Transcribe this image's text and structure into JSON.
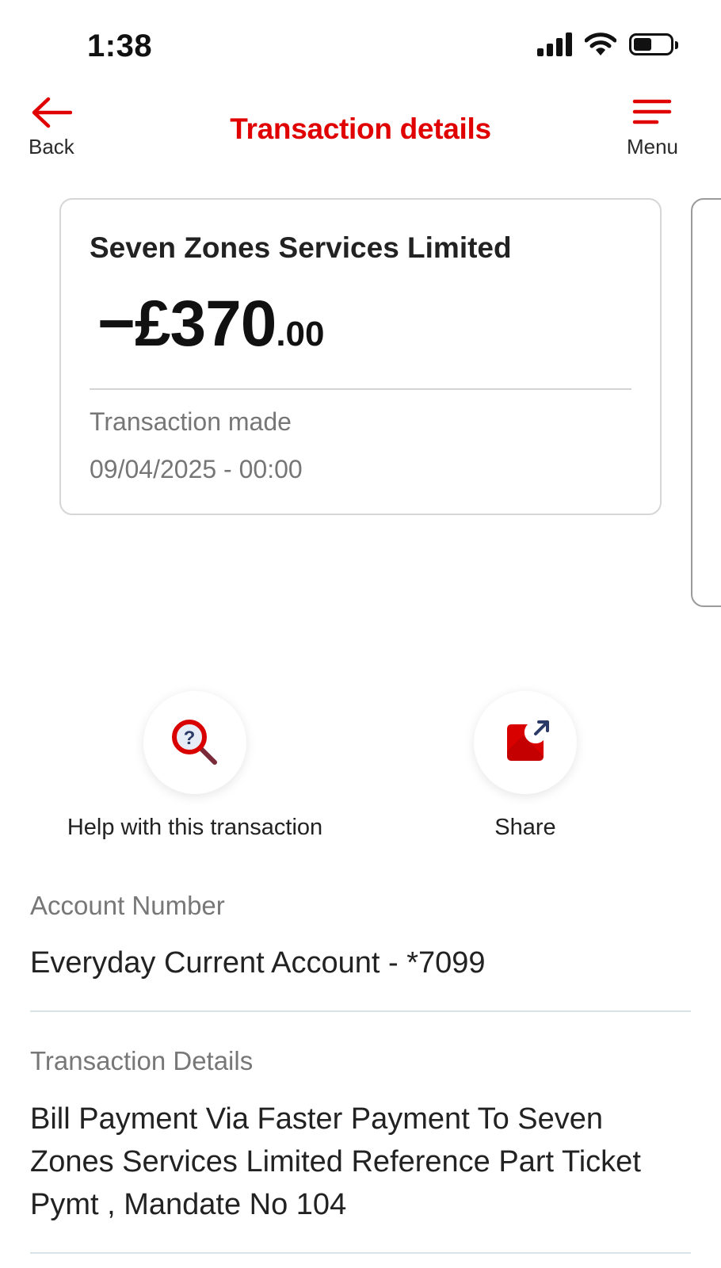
{
  "status_bar": {
    "time": "1:38"
  },
  "header": {
    "back_label": "Back",
    "title": "Transaction details",
    "menu_label": "Menu"
  },
  "card": {
    "merchant": "Seven Zones Services Limited",
    "amount_main": "−£370",
    "amount_decimal": ".00",
    "made_label": "Transaction made",
    "made_datetime": "09/04/2025 - 00:00"
  },
  "actions": {
    "help_label": "Help with this transaction",
    "share_label": "Share"
  },
  "account": {
    "label": "Account Number",
    "value": "Everyday Current Account - *7099"
  },
  "details": {
    "label": "Transaction Details",
    "value": "Bill Payment Via Faster Payment To Seven Zones Services Limited Reference Part Ticket Pymt , Mandate No 104"
  },
  "colors": {
    "brand_red": "#e00000",
    "muted_text": "#767676",
    "divider": "#d8e3e8"
  },
  "icons": [
    "signal-icon",
    "wifi-icon",
    "battery-icon",
    "back-arrow-icon",
    "menu-icon",
    "help-search-icon",
    "share-icon"
  ]
}
